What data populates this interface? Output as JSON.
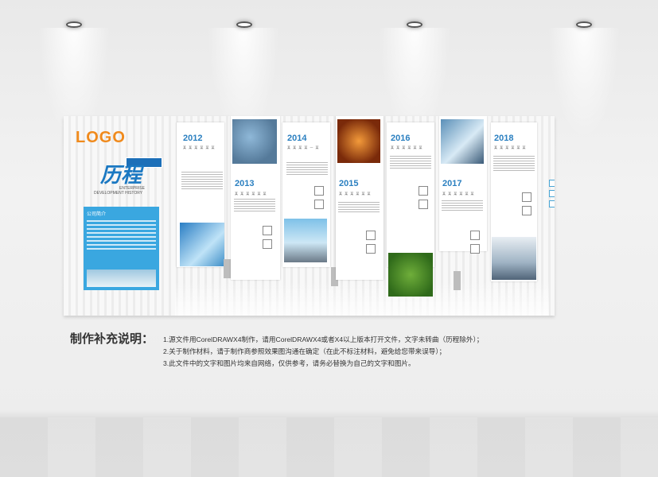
{
  "board": {
    "logo": "LOGO",
    "title": "历程",
    "subtitle_line1": "ENTERPRISE",
    "subtitle_line2": "DEVELOPMENT HISTORY",
    "intro_heading": "公司简介"
  },
  "timeline": [
    {
      "year": "2012",
      "caption": "某 某 某 某 某 某"
    },
    {
      "year": "2013",
      "caption": "某 某 某 某 某 某"
    },
    {
      "year": "2014",
      "caption": "某 某 某 某 一 某"
    },
    {
      "year": "2015",
      "caption": "某 某 某 某 某 某"
    },
    {
      "year": "2016",
      "caption": "某 某 某 某 某 某"
    },
    {
      "year": "2017",
      "caption": "某 某 某 某 某 某"
    },
    {
      "year": "2018",
      "caption": "某 某 某 某 某 某"
    }
  ],
  "notes": {
    "heading": "制作补充说明：",
    "items": [
      "1.源文件用CorelDRAWX4制作，请用CorelDRAWX4或者X4以上版本打开文件，文字未转曲（历程除外）；",
      "2.关于制作材料，请于制作商参照效果图沟通在确定（在此不标注材料，避免给您带来误导）；",
      "3.此文件中的文字和图片均来自网络，仅供参考，请务必替换为自己的文字和图片。"
    ]
  },
  "colors": {
    "accent": "#2a7fc0",
    "logo": "#f08a1c",
    "intro_bg": "#3aa7e0"
  }
}
